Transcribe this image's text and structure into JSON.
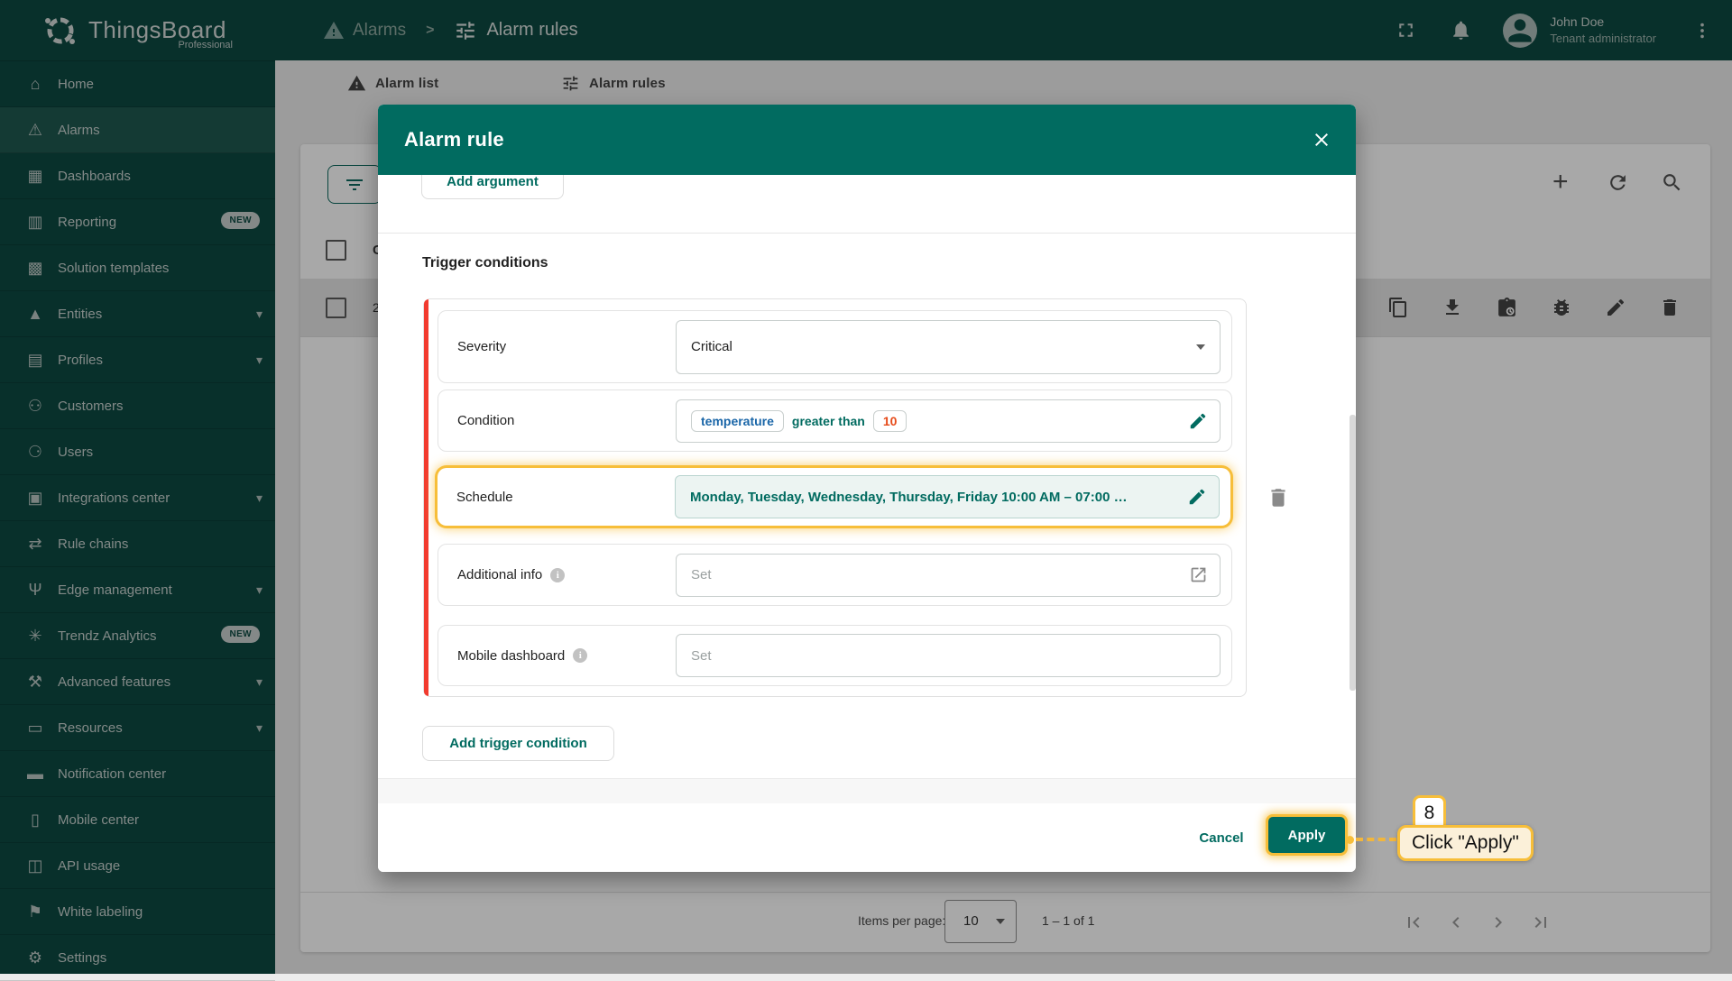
{
  "app": {
    "name": "ThingsBoard",
    "edition": "Professional"
  },
  "topbar": {
    "breadcrumb": {
      "parent": "Alarms",
      "separator": ">",
      "current": "Alarm rules",
      "parent_icon": "warning-icon",
      "current_icon": "tune-icon"
    },
    "user": {
      "name": "John Doe",
      "role": "Tenant administrator"
    },
    "icons": [
      "fullscreen-icon",
      "notifications-bell-icon",
      "avatar",
      "more-vert-icon"
    ]
  },
  "sidebar": {
    "items": [
      {
        "label": "Home",
        "icon": "home"
      },
      {
        "label": "Alarms",
        "icon": "alarms",
        "active": true
      },
      {
        "label": "Dashboards",
        "icon": "dashboards"
      },
      {
        "label": "Reporting",
        "icon": "reporting",
        "badge": "NEW"
      },
      {
        "label": "Solution templates",
        "icon": "solution"
      },
      {
        "label": "Entities",
        "icon": "entities",
        "chevron": true
      },
      {
        "label": "Profiles",
        "icon": "profiles",
        "chevron": true
      },
      {
        "label": "Customers",
        "icon": "customers"
      },
      {
        "label": "Users",
        "icon": "users"
      },
      {
        "label": "Integrations center",
        "icon": "integrations",
        "chevron": true
      },
      {
        "label": "Rule chains",
        "icon": "rulechains"
      },
      {
        "label": "Edge management",
        "icon": "edge",
        "chevron": true
      },
      {
        "label": "Trendz Analytics",
        "icon": "trendz",
        "badge": "NEW"
      },
      {
        "label": "Advanced features",
        "icon": "advanced",
        "chevron": true
      },
      {
        "label": "Resources",
        "icon": "resources",
        "chevron": true
      },
      {
        "label": "Notification center",
        "icon": "notification"
      },
      {
        "label": "Mobile center",
        "icon": "mobile"
      },
      {
        "label": "API usage",
        "icon": "api"
      },
      {
        "label": "White labeling",
        "icon": "whitelabel"
      },
      {
        "label": "Settings",
        "icon": "settings"
      }
    ]
  },
  "background": {
    "tabs": [
      {
        "label": "Alarm list",
        "icon": "warning-icon"
      },
      {
        "label": "Alarm rules",
        "icon": "tune-icon"
      }
    ],
    "table": {
      "header_cell_fragment": "C",
      "row_cell_fragment": "2",
      "row_action_icons": [
        "copy-icon",
        "download-icon",
        "assignment-icon",
        "bug-icon",
        "edit-icon",
        "delete-icon"
      ],
      "toolbar_icons": [
        "add-icon",
        "refresh-icon",
        "search-icon"
      ]
    },
    "pagination": {
      "items_per_page_label": "Items per page:",
      "items_per_page_value": "10",
      "range_label": "1 – 1 of 1",
      "pager_icons": [
        "first-page-icon",
        "previous-page-icon",
        "next-page-icon",
        "last-page-icon"
      ]
    }
  },
  "modal": {
    "title": "Alarm rule",
    "add_argument_label": "Add argument",
    "section_title": "Trigger conditions",
    "severity": {
      "label": "Severity",
      "value": "Critical"
    },
    "condition": {
      "label": "Condition",
      "argument": "temperature",
      "operation": "greater than",
      "value": "10"
    },
    "schedule": {
      "label": "Schedule",
      "value": "Monday, Tuesday, Wednesday, Thursday, Friday 10:00 AM – 07:00 …"
    },
    "additional_info": {
      "label": "Additional info",
      "placeholder": "Set"
    },
    "mobile_dashboard": {
      "label": "Mobile dashboard",
      "placeholder": "Set"
    },
    "add_trigger_label": "Add trigger condition",
    "cancel_label": "Cancel",
    "apply_label": "Apply"
  },
  "annotation": {
    "step_number": "8",
    "tooltip_text": "Click \"Apply\""
  },
  "colors": {
    "primary_teal": "#016B60",
    "sidebar_teal": "#0D4A42",
    "highlight_amber": "#F7BE39",
    "error_stripe_red": "#F23B2F",
    "chip_argument_blue": "#1A66A8",
    "chip_value_orange": "#E64A19"
  }
}
